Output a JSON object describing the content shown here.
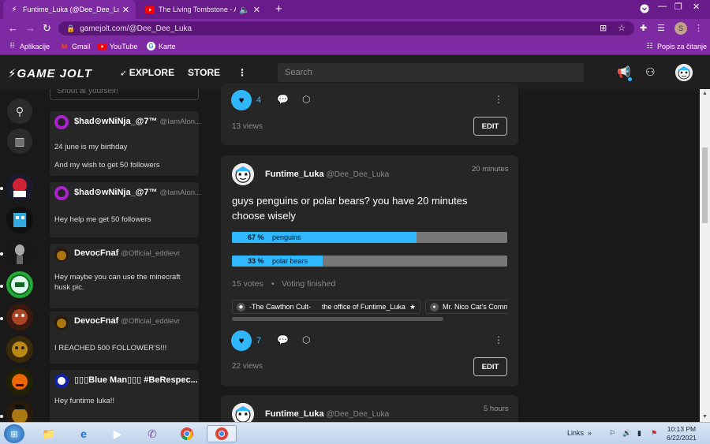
{
  "browser": {
    "tabs": [
      {
        "title": "Funtime_Luka (@Dee_Dee_Luka)",
        "icon": "gamejolt-icon",
        "active": true
      },
      {
        "title": "The Living Tombstone - Ani",
        "icon": "youtube-icon",
        "active": false
      }
    ],
    "url": "gamejolt.com/@Dee_Dee_Luka",
    "profile_initial": "S",
    "bookmarks": [
      {
        "label": "Aplikacije",
        "icon": "apps-grid-icon"
      },
      {
        "label": "Gmail",
        "icon": "gmail-icon"
      },
      {
        "label": "YouTube",
        "icon": "youtube-icon"
      },
      {
        "label": "Karte",
        "icon": "google-icon"
      }
    ],
    "reading_list": "Popis za čitanje"
  },
  "gj": {
    "nav": {
      "explore": "EXPLORE",
      "store": "STORE"
    },
    "search_placeholder": "Search",
    "accent": "#2fb8ff"
  },
  "shouts": {
    "placeholder": "Shout at yourself!",
    "items": [
      {
        "name": "$had⊙wNiNja_@7™",
        "handle": "@IamAlon...",
        "lines": [
          "24 june is my birthday",
          "And my wish to get 50 followers"
        ]
      },
      {
        "name": "$had⊙wNiNja_@7™",
        "handle": "@IamAlon...",
        "lines": [
          "Hey help me get 50 followers"
        ]
      },
      {
        "name": "DevocFnaf",
        "handle": "@Official_eddievr",
        "lines": [
          "Hey maybe you can use the minecraft husk pic."
        ]
      },
      {
        "name": "DevocFnaf",
        "handle": "@Official_eddievr",
        "lines": [
          "I REACHED 500 FOLLOWER'S!!!"
        ]
      },
      {
        "name": "▯▯▯Blue Man▯▯▯ #BeRespec...",
        "handle": "",
        "lines": [
          "Hey funtime luka!!"
        ]
      }
    ]
  },
  "feed": {
    "card1": {
      "likes": "4",
      "views": "13 views",
      "edit": "EDIT"
    },
    "card2": {
      "author": "Funtime_Luka",
      "handle": "@Dee_Dee_Luka",
      "time": "20 minutes",
      "text": "guys penguins or polar bears? you have 20 minutes choose wisely",
      "poll": [
        {
          "pct": "67 %",
          "label": "penguins",
          "value": 67
        },
        {
          "pct": "33 %",
          "label": "polar bears",
          "value": 33
        }
      ],
      "votes": "15 votes",
      "status": "Voting finished",
      "communities": [
        "-The Cawthon Cult-",
        "the office of Funtime_Luka",
        "Mr. Nico Cat's Commu"
      ],
      "likes": "7",
      "views": "22 views",
      "edit": "EDIT"
    },
    "card3": {
      "author": "Funtime_Luka",
      "handle": "@Dee_Dee_Luka",
      "time": "5 hours"
    }
  },
  "taskbar": {
    "links": "Links",
    "time": "10:13 PM",
    "date": "6/22/2021"
  }
}
